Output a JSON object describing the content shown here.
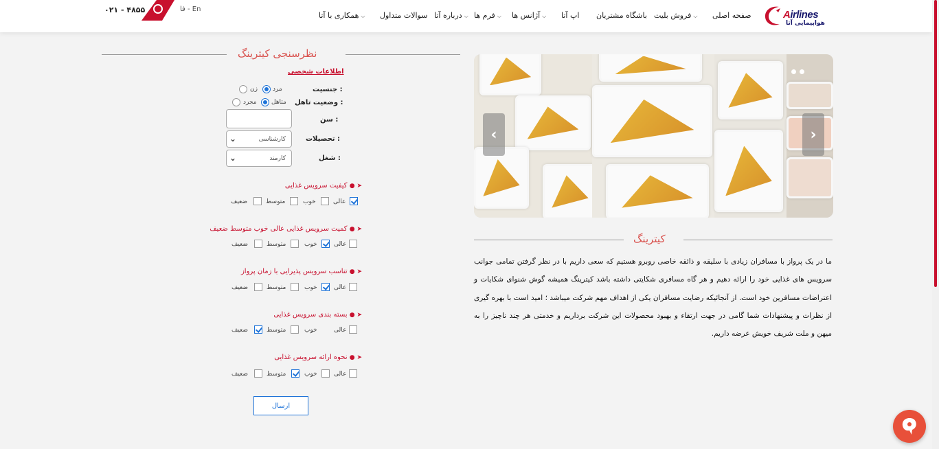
{
  "header": {
    "logo": {
      "en": "Airlines",
      "fa": "هواپیمایی آتا"
    },
    "nav": [
      {
        "label": "صفحه اصلی",
        "dropdown": false
      },
      {
        "label": "فروش بلیت",
        "dropdown": true
      },
      {
        "label": "باشگاه مشتریان",
        "dropdown": false
      },
      {
        "label": "اپ آتا",
        "dropdown": false
      },
      {
        "label": "آژانس ها",
        "dropdown": true
      },
      {
        "label": "فرم ها",
        "dropdown": true
      },
      {
        "label": "درباره آتا",
        "dropdown": true
      },
      {
        "label": "سوالات متداول",
        "dropdown": false
      },
      {
        "label": "همکاری با آتا",
        "dropdown": true
      }
    ],
    "lang": "فا - En",
    "phone": "۰۲۱ - ۴۸۵۵"
  },
  "survey": {
    "title": "نظرسنجی کیترینگ",
    "personal_info": "اطلاعات شخصی",
    "gender": {
      "label": "جنسیت :",
      "options": [
        "مرد",
        "زن"
      ],
      "selected": "مرد"
    },
    "marital": {
      "label": "وضعیت تاهل :",
      "options": [
        "متاهل",
        "مجرد"
      ],
      "selected": "متاهل"
    },
    "age": {
      "label": "سن :",
      "value": ""
    },
    "education": {
      "label": "تحصیلات :",
      "value": "کارشناسی"
    },
    "job": {
      "label": "شغل :",
      "value": "کارمند"
    },
    "questions": [
      {
        "title": "کیفیت سرویس غذایی",
        "selected": "عالی"
      },
      {
        "title": "کمیت سرویس غذایی عالی خوب متوسط ضعیف",
        "selected": "خوب"
      },
      {
        "title": "تناسب سرویس پذیرایی با زمان پرواز",
        "selected": "خوب"
      },
      {
        "title": "بسته بندی سرویس غذایی",
        "selected": "ضعیف"
      },
      {
        "title": "نحوه ارائه سرویس غذایی",
        "selected": "متوسط"
      }
    ],
    "options": [
      "عالی",
      "خوب",
      "متوسط",
      "ضعیف"
    ],
    "submit": "ارسال"
  },
  "catering": {
    "title": "کیترینگ",
    "paragraph": "ما در یک پرواز با مسافران زیادی با سلیقه و ذائقه خاصی روبرو هستیم که سعی داریم با در نظر گرفتن تمامی جوانب سرویس های غذایی خود را ارائه دهیم و هر گاه مسافری شکایتی داشته باشد کیترینگ همیشه گوش شنوای شکایات و اعتراضات مسافرین خود است. از آنجائیکه رضایت مسافران یکی از اهداف مهم شرکت میباشد ؛ امید است با بهره گیری از نظرات و پیشنهادات شما گامی در جهت ارتقاء و بهبود محصولات این شرکت برداریم و خدمتی هر چند ناچیز را به میهن و ملت شریف خویش عرضه داریم."
  },
  "colors": {
    "brand_red": "#c8102e",
    "accent_blue": "#1e73d8",
    "heading": "#d9534f"
  }
}
